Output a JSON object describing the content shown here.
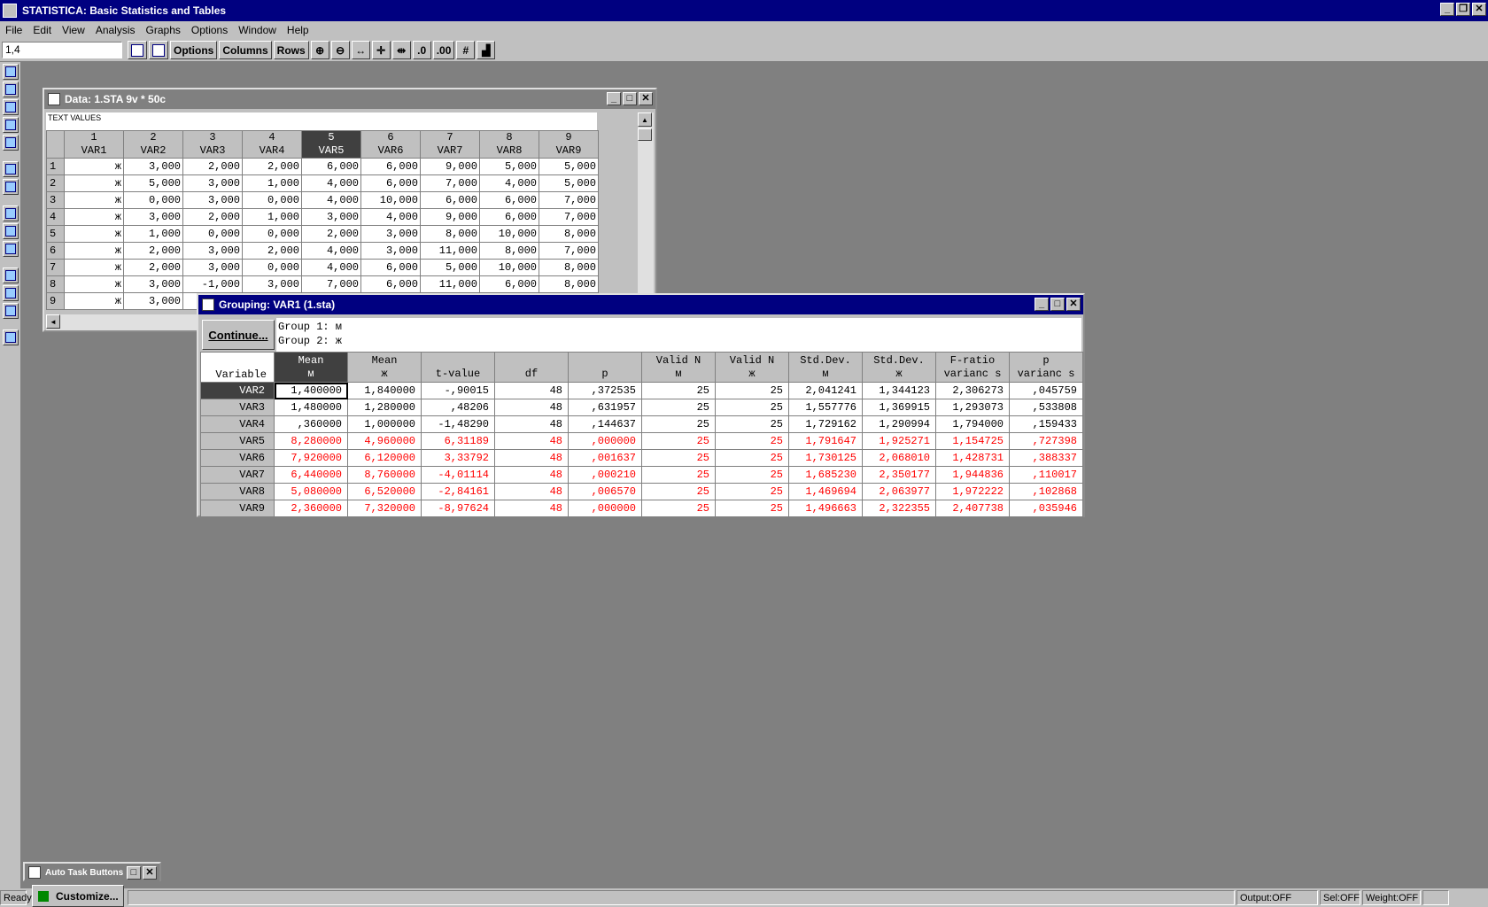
{
  "app": {
    "title": "STATISTICA: Basic Statistics and Tables"
  },
  "menu": [
    "File",
    "Edit",
    "View",
    "Analysis",
    "Graphs",
    "Options",
    "Window",
    "Help"
  ],
  "toolbar": {
    "cell_ref": "1,4",
    "options_label": "Options",
    "columns_label": "Columns",
    "rows_label": "Rows"
  },
  "data_window": {
    "title": "Data: 1.STA 9v * 50c",
    "header_text": "TEXT VALUES",
    "columns": [
      {
        "num": "1",
        "name": "VAR1"
      },
      {
        "num": "2",
        "name": "VAR2"
      },
      {
        "num": "3",
        "name": "VAR3"
      },
      {
        "num": "4",
        "name": "VAR4"
      },
      {
        "num": "5",
        "name": "VAR5"
      },
      {
        "num": "6",
        "name": "VAR6"
      },
      {
        "num": "7",
        "name": "VAR7"
      },
      {
        "num": "8",
        "name": "VAR8"
      },
      {
        "num": "9",
        "name": "VAR9"
      }
    ],
    "rows": [
      [
        "1",
        "ж",
        "3,000",
        "2,000",
        "2,000",
        "6,000",
        "6,000",
        "9,000",
        "5,000",
        "5,000"
      ],
      [
        "2",
        "ж",
        "5,000",
        "3,000",
        "1,000",
        "4,000",
        "6,000",
        "7,000",
        "4,000",
        "5,000"
      ],
      [
        "3",
        "ж",
        "0,000",
        "3,000",
        "0,000",
        "4,000",
        "10,000",
        "6,000",
        "6,000",
        "7,000"
      ],
      [
        "4",
        "ж",
        "3,000",
        "2,000",
        "1,000",
        "3,000",
        "4,000",
        "9,000",
        "6,000",
        "7,000"
      ],
      [
        "5",
        "ж",
        "1,000",
        "0,000",
        "0,000",
        "2,000",
        "3,000",
        "8,000",
        "10,000",
        "8,000"
      ],
      [
        "6",
        "ж",
        "2,000",
        "3,000",
        "2,000",
        "4,000",
        "3,000",
        "11,000",
        "8,000",
        "7,000"
      ],
      [
        "7",
        "ж",
        "2,000",
        "3,000",
        "0,000",
        "4,000",
        "6,000",
        "5,000",
        "10,000",
        "8,000"
      ],
      [
        "8",
        "ж",
        "3,000",
        "-1,000",
        "3,000",
        "7,000",
        "6,000",
        "11,000",
        "6,000",
        "8,000"
      ],
      [
        "9",
        "ж",
        "3,000"
      ]
    ]
  },
  "grouping_window": {
    "title": "Grouping: VAR1 (1.sta)",
    "continue_label": "Continue...",
    "group1": "Group 1: м",
    "group2": "Group 2: ж",
    "variable_header": "Variable",
    "headers": [
      [
        "Mean",
        "м"
      ],
      [
        "Mean",
        "ж"
      ],
      [
        "",
        "t-value"
      ],
      [
        "",
        "df"
      ],
      [
        "",
        "p"
      ],
      [
        "Valid N",
        "м"
      ],
      [
        "Valid N",
        "ж"
      ],
      [
        "Std.Dev.",
        "м"
      ],
      [
        "Std.Dev.",
        "ж"
      ],
      [
        "F-ratio",
        "varianc s"
      ],
      [
        "p",
        "varianc s"
      ]
    ],
    "rows": [
      {
        "var": "VAR2",
        "vals": [
          "1,400000",
          "1,840000",
          "-,90015",
          "48",
          ",372535",
          "25",
          "25",
          "2,041241",
          "1,344123",
          "2,306273",
          ",045759"
        ],
        "red": false
      },
      {
        "var": "VAR3",
        "vals": [
          "1,480000",
          "1,280000",
          ",48206",
          "48",
          ",631957",
          "25",
          "25",
          "1,557776",
          "1,369915",
          "1,293073",
          ",533808"
        ],
        "red": false
      },
      {
        "var": "VAR4",
        "vals": [
          ",360000",
          "1,000000",
          "-1,48290",
          "48",
          ",144637",
          "25",
          "25",
          "1,729162",
          "1,290994",
          "1,794000",
          ",159433"
        ],
        "red": false
      },
      {
        "var": "VAR5",
        "vals": [
          "8,280000",
          "4,960000",
          "6,31189",
          "48",
          ",000000",
          "25",
          "25",
          "1,791647",
          "1,925271",
          "1,154725",
          ",727398"
        ],
        "red": true
      },
      {
        "var": "VAR6",
        "vals": [
          "7,920000",
          "6,120000",
          "3,33792",
          "48",
          ",001637",
          "25",
          "25",
          "1,730125",
          "2,068010",
          "1,428731",
          ",388337"
        ],
        "red": true
      },
      {
        "var": "VAR7",
        "vals": [
          "6,440000",
          "8,760000",
          "-4,01114",
          "48",
          ",000210",
          "25",
          "25",
          "1,685230",
          "2,350177",
          "1,944836",
          ",110017"
        ],
        "red": true
      },
      {
        "var": "VAR8",
        "vals": [
          "5,080000",
          "6,520000",
          "-2,84161",
          "48",
          ",006570",
          "25",
          "25",
          "1,469694",
          "2,063977",
          "1,972222",
          ",102868"
        ],
        "red": true
      },
      {
        "var": "VAR9",
        "vals": [
          "2,360000",
          "7,320000",
          "-8,97624",
          "48",
          ",000000",
          "25",
          "25",
          "1,496663",
          "2,322355",
          "2,407738",
          ",035946"
        ],
        "red": true
      }
    ]
  },
  "autotask": {
    "title": "Auto Task Buttons",
    "customize_label": "Customize..."
  },
  "status": {
    "ready": "Ready",
    "output": "Output:OFF",
    "sel": "Sel:OFF",
    "weight": "Weight:OFF"
  },
  "colors": {
    "title_active": "#000080",
    "significant": "#ff0000",
    "desktop": "#808080"
  }
}
